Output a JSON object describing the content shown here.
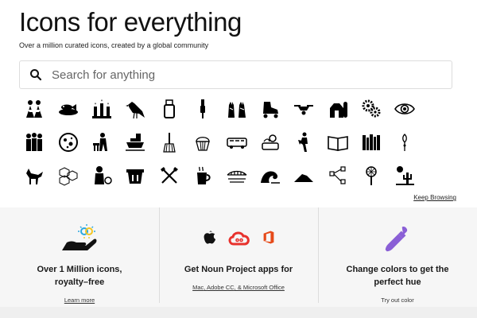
{
  "hero": {
    "title": "Icons for everything",
    "subtitle": "Over a million curated icons, created by a global community"
  },
  "search": {
    "placeholder": "Search for anything",
    "icon": "search-icon"
  },
  "icon_grid": {
    "rows": [
      [
        "people-group-icon",
        "fish-platter-icon",
        "candles-icon",
        "crow-icon",
        "usb-drive-icon",
        "audio-jack-icon",
        "hands-icon",
        "roller-skate-icon",
        "drone-icon",
        "barn-icon",
        "gears-icon",
        "eye-icon"
      ],
      [
        "family-icon",
        "moon-icon",
        "worker-icon",
        "ship-icon",
        "broom-icon",
        "cupcake-icon",
        "bus-icon",
        "picnic-icon",
        "walker-icon",
        "open-book-icon",
        "bookshelf-icon",
        "sparkle-icon"
      ],
      [
        "fox-icon",
        "hexagon-blocks-icon",
        "boy-ball-icon",
        "bucket-icon",
        "crossed-tools-icon",
        "coffee-mug-icon",
        "bridge-landscape-icon",
        "wave-icon",
        "pile-icon",
        "network-icon",
        "lollipop-icon",
        "desert-cactus-icon"
      ]
    ]
  },
  "keep_browsing": "Keep Browsing",
  "features": [
    {
      "icon": "hand-sparkle-icon",
      "title": "Over 1 Million icons, royalty–free",
      "link": "Learn more"
    },
    {
      "icons": [
        "apple-icon",
        "adobe-cc-icon",
        "microsoft-office-icon"
      ],
      "title": "Get Noun Project apps for",
      "link_parts": [
        "Mac",
        ", ",
        "Adobe CC",
        ", & ",
        "Microsoft Office"
      ]
    },
    {
      "icon": "eyedropper-icon",
      "title": "Change colors to get the perfect hue",
      "link": "Try out color"
    }
  ],
  "colors": {
    "accent_purple": "#8a5fd6",
    "adobe_red": "#e8322d",
    "office_red": "#e64a19",
    "sparkle_blue": "#2aa8e0",
    "sparkle_yellow": "#f3c623"
  }
}
